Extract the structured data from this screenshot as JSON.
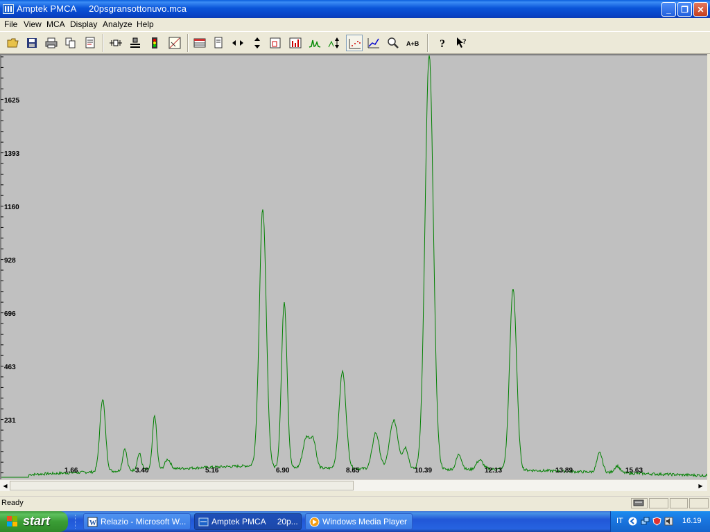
{
  "window": {
    "app_name": "Amptek PMCA",
    "file_name": "20psgransottonuvo.mca",
    "title": "Amptek PMCA     20psgransottonuvo.mca",
    "buttons": {
      "minimize": "_",
      "restore": "❐",
      "close": "✕"
    }
  },
  "menu": [
    "File",
    "View",
    "MCA",
    "Display",
    "Analyze",
    "Help"
  ],
  "toolbar": {
    "buttons": [
      "open-file",
      "save-file",
      "print",
      "copy",
      "report",
      "connect",
      "adjust",
      "traffic-light",
      "calibrate",
      "roi-table",
      "page",
      "horizontal-expand",
      "vertical-expand",
      "roi-zoom",
      "bar-chart",
      "peaks",
      "auto-scale",
      "dot-plot",
      "line-plot",
      "zoom",
      "a-plus-b",
      "help",
      "context-help"
    ],
    "a_plus_b_label": "A+B",
    "active": "dot-plot"
  },
  "spectrum": {
    "y_ticks": [
      "1625",
      "1393",
      "1160",
      "928",
      "696",
      "463",
      "231"
    ],
    "x_ticks": [
      "1.66",
      "3.40",
      "5.16",
      "6.90",
      "8.65",
      "10.39",
      "12.13",
      "13.89",
      "15.63"
    ],
    "line_color": "#008000",
    "background_color": "#c0c0c0"
  },
  "status": {
    "text": "Ready"
  },
  "taskbar": {
    "start_label": "start",
    "tasks": [
      {
        "label": "Relazio - Microsoft W...",
        "active": false
      },
      {
        "label": "Amptek PMCA     20p...",
        "active": true
      },
      {
        "label": "Windows Media Player",
        "active": false
      }
    ],
    "tray": {
      "language": "IT",
      "clock": "16.19"
    }
  }
}
